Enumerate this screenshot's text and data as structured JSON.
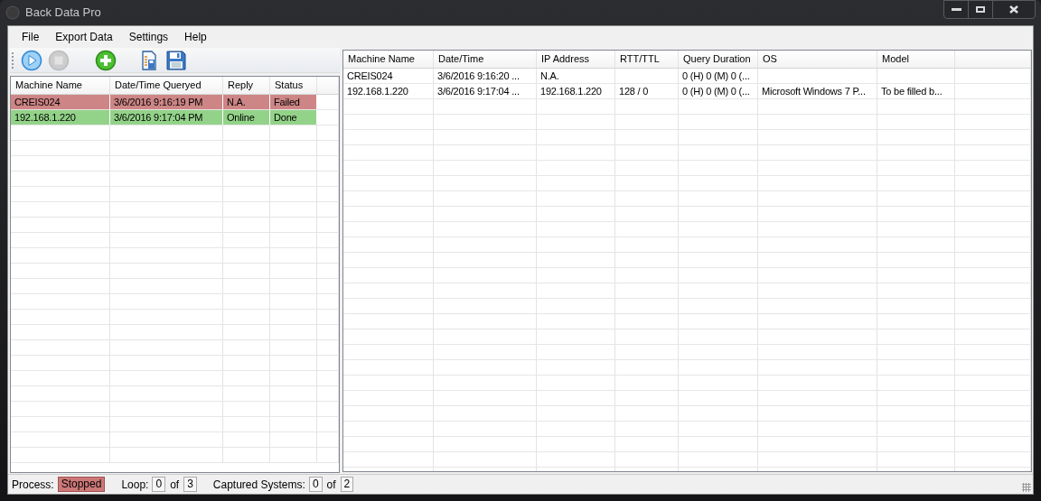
{
  "window": {
    "title": "Back Data Pro"
  },
  "menu": [
    "File",
    "Export Data",
    "Settings",
    "Help"
  ],
  "toolbar": [
    {
      "kind": "play",
      "disabled": false
    },
    {
      "kind": "stop",
      "disabled": true
    },
    {
      "kind": "add",
      "disabled": false
    },
    {
      "kind": "report",
      "disabled": false
    },
    {
      "kind": "save",
      "disabled": false
    }
  ],
  "queue_table": {
    "columns": [
      "Machine Name",
      "Date/Time Queryed",
      "Reply",
      "Status"
    ],
    "rows": [
      {
        "cells": [
          "CREIS024",
          "3/6/2016 9:16:19 PM",
          "N.A.",
          "Failed"
        ],
        "color": "#cd8585"
      },
      {
        "cells": [
          "192.168.1.220",
          "3/6/2016 9:17:04 PM",
          "Online",
          "Done"
        ],
        "color": "#93d389"
      }
    ]
  },
  "results_table": {
    "columns": [
      "Machine Name",
      "Date/Time",
      "IP Address",
      "RTT/TTL",
      "Query Duration",
      "OS",
      "Model"
    ],
    "rows": [
      [
        "CREIS024",
        "3/6/2016 9:16:20 ...",
        "N.A.",
        "",
        "0 (H) 0 (M) 0 (...",
        "",
        ""
      ],
      [
        "192.168.1.220",
        "3/6/2016 9:17:04 ...",
        "192.168.1.220",
        "128 / 0",
        "0 (H) 0 (M) 0 (...",
        "Microsoft Windows 7 P...",
        "To be filled b..."
      ]
    ]
  },
  "status_bar": {
    "process_label": "Process:",
    "process_state": "Stopped",
    "stopped": true,
    "loop_label": "Loop:",
    "loop_current": "0",
    "loop_of": "of",
    "loop_total": "3",
    "captured_label": "Captured Systems:",
    "captured_current": "0",
    "captured_of": "of",
    "captured_total": "2"
  }
}
